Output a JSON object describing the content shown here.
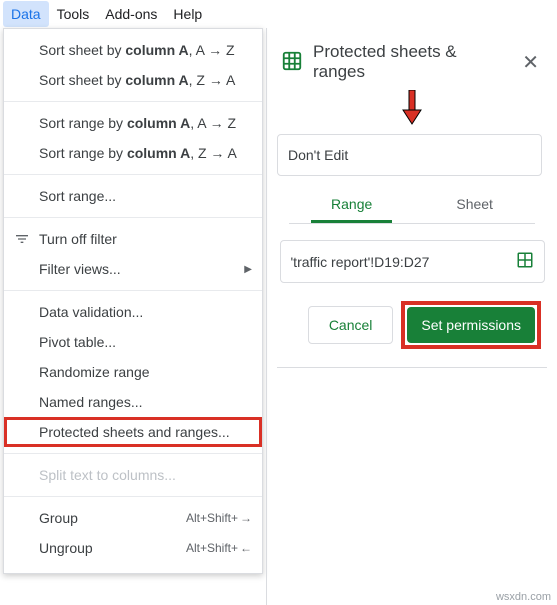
{
  "menubar": {
    "data": "Data",
    "tools": "Tools",
    "addons": "Add-ons",
    "help": "Help"
  },
  "dropdown": {
    "sort_sheet_az_pre": "Sort sheet by ",
    "sort_sheet_az_col": "column A",
    "sort_sheet_az_post": ", A → Z",
    "sort_sheet_za_pre": "Sort sheet by ",
    "sort_sheet_za_col": "column A",
    "sort_sheet_za_post": ", Z → A",
    "sort_range_az_pre": "Sort range by ",
    "sort_range_az_col": "column A",
    "sort_range_az_post": ", A → Z",
    "sort_range_za_pre": "Sort range by ",
    "sort_range_za_col": "column A",
    "sort_range_za_post": ", Z → A",
    "sort_range": "Sort range...",
    "turn_off_filter": "Turn off filter",
    "filter_views": "Filter views...",
    "data_validation": "Data validation...",
    "pivot_table": "Pivot table...",
    "randomize_range": "Randomize range",
    "named_ranges": "Named ranges...",
    "protected": "Protected sheets and ranges...",
    "split_text": "Split text to columns...",
    "group": "Group",
    "group_shortcut": "Alt+Shift+",
    "ungroup": "Ungroup",
    "ungroup_shortcut": "Alt+Shift+"
  },
  "panel": {
    "title": "Protected sheets & ranges",
    "description": "Don't Edit",
    "tab_range": "Range",
    "tab_sheet": "Sheet",
    "range_value": "'traffic report'!D19:D27",
    "cancel": "Cancel",
    "set_permissions": "Set permissions"
  },
  "watermark": "wsxdn.com"
}
